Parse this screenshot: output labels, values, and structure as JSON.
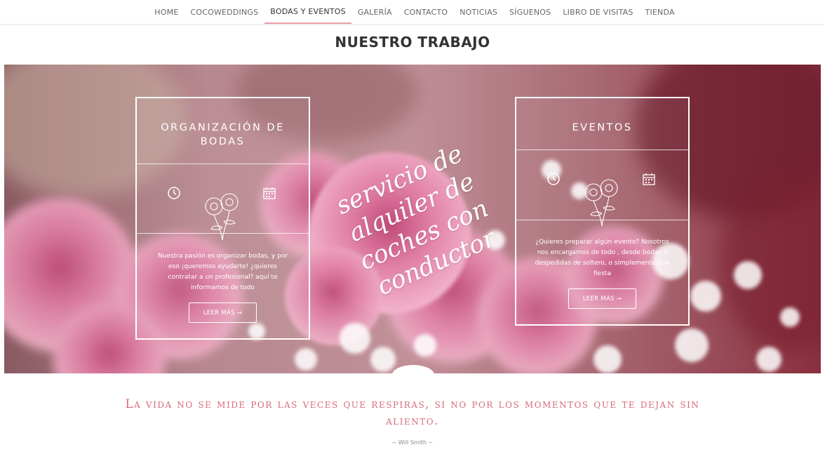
{
  "nav": {
    "items": [
      {
        "label": "HOME"
      },
      {
        "label": "COCOWEDDINGS"
      },
      {
        "label": "BODAS Y EVENTOS"
      },
      {
        "label": "GALERÍA"
      },
      {
        "label": "CONTACTO"
      },
      {
        "label": "NOTICIAS"
      },
      {
        "label": "SÍGUENOS"
      },
      {
        "label": "LIBRO DE VISITAS"
      },
      {
        "label": "TIENDA"
      }
    ],
    "active_index": 2
  },
  "section_title": "NUESTRO TRABAJO",
  "cards": [
    {
      "title": "ORGANIZACIÓN DE BODAS",
      "description": "Nuestra pasión es organizar bodas, y por eso ¡queremos ayudarte! ¿quieres contratar a un profesional? aquí te informamos de todo",
      "button": "LEER MÁS →",
      "icons": [
        "clock-icon",
        "flower-icon",
        "calendar-icon"
      ]
    },
    {
      "title": "EVENTOS",
      "description": "¿Quieres preparar algún evento? Nosotros nos encargamos de todo , desde bodas a despedidas de soltero, o simplemente una fiesta",
      "button": "LEER MÁS →",
      "icons": [
        "clock-icon",
        "flower-icon",
        "calendar-icon"
      ]
    }
  ],
  "script_text": "servicio de alquiler de coches con conductor",
  "quote": "La vida no se mide por las veces que respiras, si no por los momentos que te dejan sin aliento.",
  "author": "~ Will Smith ~",
  "colors": {
    "accent": "#e8a0a8",
    "quote": "#d96a7a"
  }
}
